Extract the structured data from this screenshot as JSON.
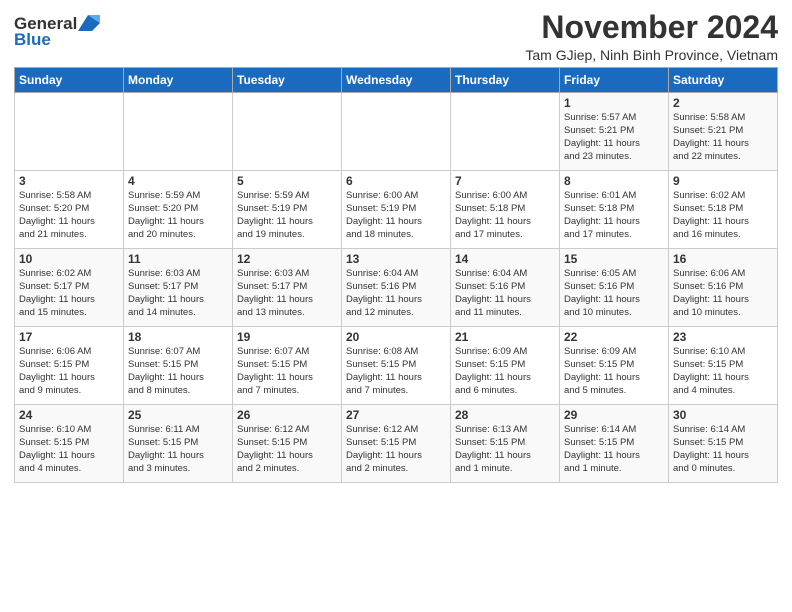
{
  "logo": {
    "general": "General",
    "blue": "Blue"
  },
  "header": {
    "month": "November 2024",
    "location": "Tam GJiep, Ninh Binh Province, Vietnam"
  },
  "days_of_week": [
    "Sunday",
    "Monday",
    "Tuesday",
    "Wednesday",
    "Thursday",
    "Friday",
    "Saturday"
  ],
  "weeks": [
    {
      "days": [
        {
          "num": "",
          "info": ""
        },
        {
          "num": "",
          "info": ""
        },
        {
          "num": "",
          "info": ""
        },
        {
          "num": "",
          "info": ""
        },
        {
          "num": "",
          "info": ""
        },
        {
          "num": "1",
          "info": "Sunrise: 5:57 AM\nSunset: 5:21 PM\nDaylight: 11 hours\nand 23 minutes."
        },
        {
          "num": "2",
          "info": "Sunrise: 5:58 AM\nSunset: 5:21 PM\nDaylight: 11 hours\nand 22 minutes."
        }
      ]
    },
    {
      "days": [
        {
          "num": "3",
          "info": "Sunrise: 5:58 AM\nSunset: 5:20 PM\nDaylight: 11 hours\nand 21 minutes."
        },
        {
          "num": "4",
          "info": "Sunrise: 5:59 AM\nSunset: 5:20 PM\nDaylight: 11 hours\nand 20 minutes."
        },
        {
          "num": "5",
          "info": "Sunrise: 5:59 AM\nSunset: 5:19 PM\nDaylight: 11 hours\nand 19 minutes."
        },
        {
          "num": "6",
          "info": "Sunrise: 6:00 AM\nSunset: 5:19 PM\nDaylight: 11 hours\nand 18 minutes."
        },
        {
          "num": "7",
          "info": "Sunrise: 6:00 AM\nSunset: 5:18 PM\nDaylight: 11 hours\nand 17 minutes."
        },
        {
          "num": "8",
          "info": "Sunrise: 6:01 AM\nSunset: 5:18 PM\nDaylight: 11 hours\nand 17 minutes."
        },
        {
          "num": "9",
          "info": "Sunrise: 6:02 AM\nSunset: 5:18 PM\nDaylight: 11 hours\nand 16 minutes."
        }
      ]
    },
    {
      "days": [
        {
          "num": "10",
          "info": "Sunrise: 6:02 AM\nSunset: 5:17 PM\nDaylight: 11 hours\nand 15 minutes."
        },
        {
          "num": "11",
          "info": "Sunrise: 6:03 AM\nSunset: 5:17 PM\nDaylight: 11 hours\nand 14 minutes."
        },
        {
          "num": "12",
          "info": "Sunrise: 6:03 AM\nSunset: 5:17 PM\nDaylight: 11 hours\nand 13 minutes."
        },
        {
          "num": "13",
          "info": "Sunrise: 6:04 AM\nSunset: 5:16 PM\nDaylight: 11 hours\nand 12 minutes."
        },
        {
          "num": "14",
          "info": "Sunrise: 6:04 AM\nSunset: 5:16 PM\nDaylight: 11 hours\nand 11 minutes."
        },
        {
          "num": "15",
          "info": "Sunrise: 6:05 AM\nSunset: 5:16 PM\nDaylight: 11 hours\nand 10 minutes."
        },
        {
          "num": "16",
          "info": "Sunrise: 6:06 AM\nSunset: 5:16 PM\nDaylight: 11 hours\nand 10 minutes."
        }
      ]
    },
    {
      "days": [
        {
          "num": "17",
          "info": "Sunrise: 6:06 AM\nSunset: 5:15 PM\nDaylight: 11 hours\nand 9 minutes."
        },
        {
          "num": "18",
          "info": "Sunrise: 6:07 AM\nSunset: 5:15 PM\nDaylight: 11 hours\nand 8 minutes."
        },
        {
          "num": "19",
          "info": "Sunrise: 6:07 AM\nSunset: 5:15 PM\nDaylight: 11 hours\nand 7 minutes."
        },
        {
          "num": "20",
          "info": "Sunrise: 6:08 AM\nSunset: 5:15 PM\nDaylight: 11 hours\nand 7 minutes."
        },
        {
          "num": "21",
          "info": "Sunrise: 6:09 AM\nSunset: 5:15 PM\nDaylight: 11 hours\nand 6 minutes."
        },
        {
          "num": "22",
          "info": "Sunrise: 6:09 AM\nSunset: 5:15 PM\nDaylight: 11 hours\nand 5 minutes."
        },
        {
          "num": "23",
          "info": "Sunrise: 6:10 AM\nSunset: 5:15 PM\nDaylight: 11 hours\nand 4 minutes."
        }
      ]
    },
    {
      "days": [
        {
          "num": "24",
          "info": "Sunrise: 6:10 AM\nSunset: 5:15 PM\nDaylight: 11 hours\nand 4 minutes."
        },
        {
          "num": "25",
          "info": "Sunrise: 6:11 AM\nSunset: 5:15 PM\nDaylight: 11 hours\nand 3 minutes."
        },
        {
          "num": "26",
          "info": "Sunrise: 6:12 AM\nSunset: 5:15 PM\nDaylight: 11 hours\nand 2 minutes."
        },
        {
          "num": "27",
          "info": "Sunrise: 6:12 AM\nSunset: 5:15 PM\nDaylight: 11 hours\nand 2 minutes."
        },
        {
          "num": "28",
          "info": "Sunrise: 6:13 AM\nSunset: 5:15 PM\nDaylight: 11 hours\nand 1 minute."
        },
        {
          "num": "29",
          "info": "Sunrise: 6:14 AM\nSunset: 5:15 PM\nDaylight: 11 hours\nand 1 minute."
        },
        {
          "num": "30",
          "info": "Sunrise: 6:14 AM\nSunset: 5:15 PM\nDaylight: 11 hours\nand 0 minutes."
        }
      ]
    }
  ]
}
